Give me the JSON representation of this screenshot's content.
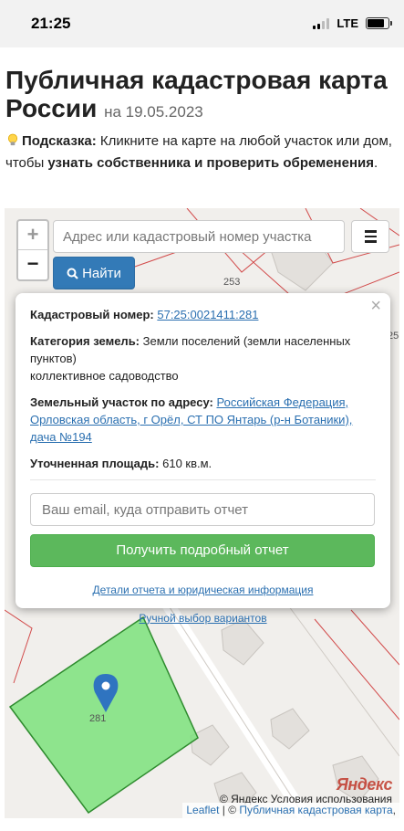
{
  "status_bar": {
    "time": "21:25",
    "network": "LTE"
  },
  "header": {
    "title": "Публичная кадастровая карта России",
    "date": "на 19.05.2023"
  },
  "hint": {
    "label": "Подсказка:",
    "text_1": "Кликните на карте на любой участок или дом, чтобы",
    "bold_text": "узнать собственника и проверить обременения",
    "end": "."
  },
  "map": {
    "zoom_in": "+",
    "zoom_out": "−",
    "search_placeholder": "Адрес или кадастровый номер участка",
    "find_button": "Найти",
    "plot_labels": {
      "a": "253",
      "b": "281",
      "c": "25("
    },
    "attribution": {
      "leaflet": "Leaflet",
      "sep": " | © ",
      "pkk": "Публичная кадастровая карта",
      "end": ","
    },
    "yandex_logo": "Яндекс",
    "yandex_terms": "© Яндекс  Условия использования"
  },
  "popup": {
    "close": "×",
    "cadastral_label": "Кадастровый номер:",
    "cadastral_value": "57:25:0021411:281",
    "category_label": "Категория земель:",
    "category_value": "Земли поселений (земли населенных пунктов)",
    "category_use": "коллективное садоводство",
    "address_label": "Земельный участок по адресу:",
    "address_value": "Российская Федерация, Орловская область, г Орёл, СТ ПО Янтарь (р-н Ботаники), дача №194",
    "area_label": "Уточненная площадь:",
    "area_value": "610 кв.м.",
    "email_placeholder": "Ваш email, куда отправить отчет",
    "report_button": "Получить подробный отчет",
    "details_link": "Детали отчета и юридическая информация",
    "manual_link": "Ручной выбор вариантов"
  },
  "colors": {
    "plot_fill": "#7ce27c",
    "plot_border": "#2e8b2e",
    "boundary": "#d24a4a",
    "marker": "#2f74c0",
    "find_button": "#337ab7",
    "report_button": "#5cb85c"
  }
}
